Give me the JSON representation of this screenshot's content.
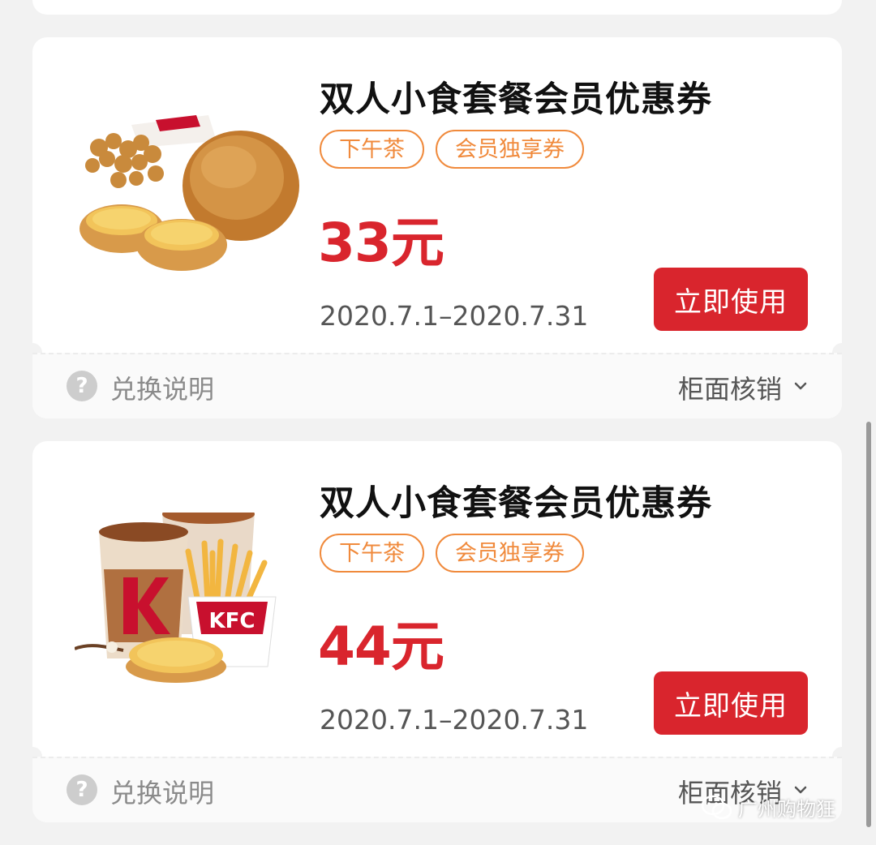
{
  "coupons": [
    {
      "title": "双人小食套餐会员优惠券",
      "tags": [
        "下午茶",
        "会员独享券"
      ],
      "price": "33元",
      "validity": "2020.7.1–2020.7.31",
      "button_label": "立即使用",
      "redeem_label": "兑换说明",
      "counter_label": "柜面核销",
      "image": "chicken-nuggets-egg-tarts"
    },
    {
      "title": "双人小食套餐会员优惠券",
      "tags": [
        "下午茶",
        "会员独享券"
      ],
      "price": "44元",
      "validity": "2020.7.1–2020.7.31",
      "button_label": "立即使用",
      "redeem_label": "兑换说明",
      "counter_label": "柜面核销",
      "image": "coffee-fries-egg-tart"
    }
  ],
  "help_icon_glyph": "?",
  "watermark": "广州购物狂",
  "colors": {
    "accent_red": "#d9252d",
    "tag_orange": "#f08a3c",
    "background": "#f2f2f2"
  }
}
